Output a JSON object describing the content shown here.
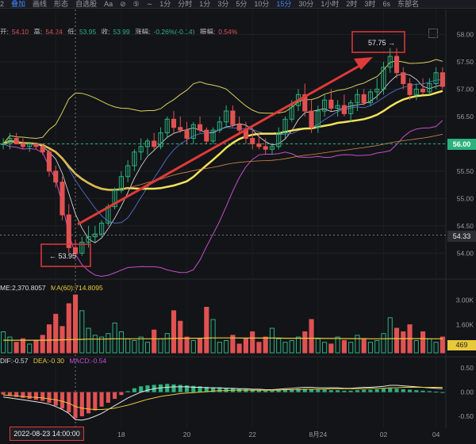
{
  "toolbar": {
    "items": [
      "2",
      "叠加",
      "画线",
      "形态",
      "自选股",
      "Aa",
      "⊘",
      "⑤",
      "∼",
      "1分",
      "分时",
      "1分",
      "3分",
      "5分",
      "10分",
      "15分",
      "30分",
      "1小时",
      "2时",
      "3时",
      "6s",
      "东部名"
    ]
  },
  "info": {
    "open_label": "开:",
    "open": "54.10",
    "high_label": "高:",
    "high": "54.24",
    "low_label": "低:",
    "low": "53.95",
    "close_label": "收:",
    "close": "53.99",
    "chg_label": "涨幅:",
    "chg": "-0.26%(-0.14)",
    "amp_label": "振幅:",
    "amp": "0.54%"
  },
  "volume": {
    "label": "ME:2,370.8057",
    "ma_label": "MA(60):714.8095",
    "ticks": [
      "3.00K",
      "1.60K",
      "469"
    ]
  },
  "macd": {
    "dif": "DIF:-0.57",
    "dea": "DEA:-0.30",
    "macd": "MACD:-0.54",
    "ticks": [
      "0.50",
      "0.00",
      "-0.50"
    ]
  },
  "price_tags": {
    "current": "56.00",
    "cursor": "54.33"
  },
  "annotations": {
    "low": "← 53.95",
    "high": "57.75 →"
  },
  "cursor_date": "2022-08-23 14:00:00",
  "chart_data": {
    "type": "candlestick",
    "ylim": [
      53.7,
      58.05
    ],
    "yticks": [
      54.0,
      54.5,
      55.0,
      55.5,
      56.0,
      56.5,
      57.0,
      57.5,
      58.0
    ],
    "xticks": [
      "16",
      "18",
      "20",
      "22",
      "8月24",
      "02",
      "04"
    ],
    "candles": [
      [
        56.0,
        56.1,
        55.9,
        56.0
      ],
      [
        56.0,
        56.2,
        55.9,
        56.1
      ],
      [
        56.1,
        56.2,
        56.0,
        56.0
      ],
      [
        56.0,
        56.1,
        55.9,
        55.95
      ],
      [
        55.95,
        56.0,
        55.85,
        56.0
      ],
      [
        56.0,
        56.0,
        55.9,
        55.95
      ],
      [
        55.95,
        56.0,
        55.8,
        55.85
      ],
      [
        55.85,
        55.9,
        55.4,
        55.5
      ],
      [
        55.5,
        55.6,
        55.2,
        55.3
      ],
      [
        55.3,
        55.4,
        54.6,
        54.7
      ],
      [
        54.7,
        54.9,
        54.0,
        54.1
      ],
      [
        54.1,
        54.24,
        53.95,
        53.99
      ],
      [
        54.0,
        54.3,
        53.95,
        54.2
      ],
      [
        54.2,
        54.5,
        54.1,
        54.3
      ],
      [
        54.3,
        54.5,
        54.2,
        54.35
      ],
      [
        54.35,
        54.6,
        54.3,
        54.55
      ],
      [
        54.55,
        54.9,
        54.5,
        54.85
      ],
      [
        54.85,
        55.2,
        54.8,
        55.15
      ],
      [
        55.15,
        55.5,
        55.1,
        55.4
      ],
      [
        55.4,
        55.7,
        55.3,
        55.6
      ],
      [
        55.6,
        55.9,
        55.5,
        55.85
      ],
      [
        55.85,
        56.1,
        55.7,
        55.95
      ],
      [
        55.95,
        56.1,
        55.8,
        56.05
      ],
      [
        56.05,
        56.2,
        55.9,
        55.95
      ],
      [
        55.95,
        56.3,
        55.9,
        56.2
      ],
      [
        56.2,
        56.5,
        56.1,
        56.45
      ],
      [
        56.45,
        56.6,
        56.2,
        56.3
      ],
      [
        56.3,
        56.5,
        56.2,
        56.25
      ],
      [
        56.25,
        56.4,
        56.0,
        56.1
      ],
      [
        56.1,
        56.4,
        56.0,
        56.35
      ],
      [
        56.35,
        56.5,
        56.2,
        56.25
      ],
      [
        56.25,
        56.3,
        56.0,
        56.05
      ],
      [
        56.05,
        56.3,
        56.0,
        56.25
      ],
      [
        56.25,
        56.5,
        56.2,
        56.4
      ],
      [
        56.4,
        56.7,
        56.3,
        56.6
      ],
      [
        56.6,
        56.7,
        56.3,
        56.35
      ],
      [
        56.35,
        56.5,
        56.2,
        56.25
      ],
      [
        56.25,
        56.4,
        56.0,
        56.1
      ],
      [
        56.1,
        56.3,
        55.9,
        56.0
      ],
      [
        56.0,
        56.2,
        55.9,
        55.95
      ],
      [
        55.95,
        56.1,
        55.8,
        55.9
      ],
      [
        55.9,
        56.0,
        55.8,
        55.95
      ],
      [
        55.95,
        56.3,
        55.9,
        56.2
      ],
      [
        56.2,
        56.5,
        56.1,
        56.45
      ],
      [
        56.45,
        56.8,
        56.4,
        56.7
      ],
      [
        56.7,
        57.0,
        56.6,
        56.9
      ],
      [
        56.9,
        57.1,
        56.5,
        56.6
      ],
      [
        56.6,
        56.8,
        56.2,
        56.3
      ],
      [
        56.3,
        56.7,
        56.2,
        56.6
      ],
      [
        56.6,
        56.9,
        56.5,
        56.8
      ],
      [
        56.8,
        57.0,
        56.6,
        56.65
      ],
      [
        56.65,
        56.8,
        56.5,
        56.7
      ],
      [
        56.7,
        56.9,
        56.5,
        56.55
      ],
      [
        56.55,
        56.8,
        56.4,
        56.75
      ],
      [
        56.75,
        57.0,
        56.6,
        56.9
      ],
      [
        56.9,
        57.0,
        56.7,
        56.75
      ],
      [
        56.75,
        57.0,
        56.7,
        56.95
      ],
      [
        56.95,
        57.2,
        56.8,
        57.0
      ],
      [
        57.0,
        57.5,
        56.9,
        57.4
      ],
      [
        57.4,
        57.75,
        57.3,
        57.6
      ],
      [
        57.6,
        57.75,
        57.2,
        57.3
      ],
      [
        57.3,
        57.4,
        57.0,
        57.1
      ],
      [
        57.1,
        57.2,
        56.8,
        56.9
      ],
      [
        56.9,
        57.1,
        56.8,
        57.0
      ],
      [
        57.0,
        57.2,
        56.9,
        56.95
      ],
      [
        56.95,
        57.2,
        56.9,
        57.1
      ],
      [
        57.1,
        57.4,
        57.0,
        57.3
      ],
      [
        57.3,
        57.4,
        57.0,
        57.05
      ]
    ],
    "volume_max": 3.3,
    "volume": [
      1.2,
      0.9,
      0.6,
      0.8,
      0.5,
      0.7,
      1.0,
      1.6,
      2.2,
      1.5,
      2.8,
      3.3,
      2.4,
      1.4,
      1.0,
      0.9,
      1.1,
      1.7,
      1.2,
      0.8,
      0.7,
      0.9,
      0.6,
      1.3,
      0.8,
      1.1,
      2.4,
      1.8,
      0.9,
      0.7,
      0.8,
      2.6,
      1.9,
      0.6,
      0.7,
      1.0,
      0.5,
      0.8,
      1.2,
      0.6,
      0.9,
      1.4,
      0.8,
      0.6,
      0.7,
      0.9,
      1.2,
      1.9,
      0.8,
      0.6,
      0.5,
      0.9,
      0.7,
      0.6,
      1.0,
      0.8,
      0.6,
      0.7,
      1.1,
      2.0,
      1.4,
      1.2,
      1.6,
      0.7,
      1.2,
      0.8,
      0.6,
      0.9
    ],
    "vol_ma": [
      0.72,
      0.72,
      0.72,
      0.72,
      0.72,
      0.72,
      0.72,
      0.73,
      0.73,
      0.74,
      0.75,
      0.76,
      0.77,
      0.78,
      0.78,
      0.78,
      0.79,
      0.8,
      0.8,
      0.8,
      0.8,
      0.8,
      0.8,
      0.8,
      0.8,
      0.81,
      0.82,
      0.83,
      0.83,
      0.83,
      0.83,
      0.84,
      0.85,
      0.85,
      0.85,
      0.85,
      0.84,
      0.84,
      0.84,
      0.84,
      0.84,
      0.84,
      0.84,
      0.83,
      0.83,
      0.83,
      0.83,
      0.83,
      0.83,
      0.82,
      0.82,
      0.82,
      0.81,
      0.81,
      0.81,
      0.81,
      0.8,
      0.8,
      0.8,
      0.81,
      0.81,
      0.81,
      0.81,
      0.81,
      0.81,
      0.8,
      0.8,
      0.8
    ],
    "macd_ylim": [
      -0.68,
      0.6
    ],
    "macd": [
      -0.05,
      -0.08,
      -0.1,
      -0.12,
      -0.14,
      -0.16,
      -0.18,
      -0.22,
      -0.28,
      -0.34,
      -0.42,
      -0.54,
      -0.5,
      -0.44,
      -0.38,
      -0.3,
      -0.22,
      -0.14,
      -0.06,
      0.02,
      0.08,
      0.12,
      0.14,
      0.15,
      0.16,
      0.17,
      0.16,
      0.15,
      0.14,
      0.13,
      0.12,
      0.11,
      0.1,
      0.1,
      0.09,
      0.08,
      0.07,
      0.06,
      0.05,
      0.04,
      0.03,
      0.03,
      0.04,
      0.05,
      0.06,
      0.07,
      0.07,
      0.06,
      0.05,
      0.05,
      0.04,
      0.04,
      0.03,
      0.03,
      0.04,
      0.05,
      0.05,
      0.06,
      0.07,
      0.08,
      0.07,
      0.06,
      0.05,
      0.04,
      0.03,
      0.02,
      0.01,
      0.0
    ],
    "dif": [
      -0.1,
      -0.12,
      -0.14,
      -0.16,
      -0.18,
      -0.2,
      -0.22,
      -0.25,
      -0.3,
      -0.36,
      -0.44,
      -0.57,
      -0.58,
      -0.55,
      -0.5,
      -0.44,
      -0.36,
      -0.28,
      -0.2,
      -0.12,
      -0.06,
      0.0,
      0.04,
      0.07,
      0.09,
      0.1,
      0.11,
      0.11,
      0.11,
      0.1,
      0.1,
      0.09,
      0.09,
      0.09,
      0.08,
      0.08,
      0.07,
      0.07,
      0.06,
      0.06,
      0.05,
      0.05,
      0.06,
      0.07,
      0.08,
      0.09,
      0.1,
      0.1,
      0.09,
      0.09,
      0.09,
      0.09,
      0.08,
      0.08,
      0.09,
      0.1,
      0.1,
      0.11,
      0.12,
      0.14,
      0.14,
      0.13,
      0.12,
      0.11,
      0.1,
      0.09,
      0.08,
      0.07
    ],
    "dea": [
      -0.06,
      -0.07,
      -0.08,
      -0.09,
      -0.1,
      -0.11,
      -0.12,
      -0.14,
      -0.16,
      -0.19,
      -0.23,
      -0.3,
      -0.33,
      -0.35,
      -0.36,
      -0.36,
      -0.35,
      -0.33,
      -0.3,
      -0.27,
      -0.23,
      -0.19,
      -0.15,
      -0.12,
      -0.09,
      -0.07,
      -0.05,
      -0.03,
      -0.02,
      -0.01,
      0.0,
      0.01,
      0.02,
      0.03,
      0.03,
      0.04,
      0.04,
      0.04,
      0.04,
      0.04,
      0.04,
      0.04,
      0.04,
      0.05,
      0.05,
      0.05,
      0.06,
      0.06,
      0.06,
      0.06,
      0.07,
      0.07,
      0.07,
      0.07,
      0.07,
      0.07,
      0.08,
      0.08,
      0.08,
      0.09,
      0.09,
      0.1,
      0.1,
      0.1,
      0.1,
      0.1,
      0.1,
      0.1
    ]
  }
}
